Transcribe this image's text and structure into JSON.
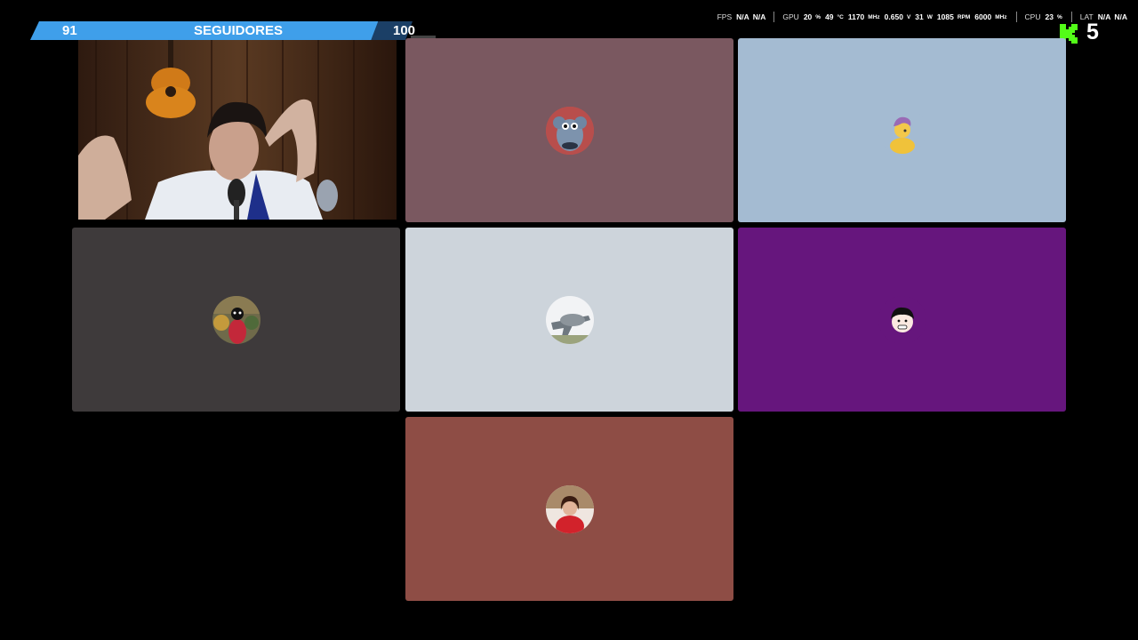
{
  "followers": {
    "current": "91",
    "label": "SEGUIDORES",
    "goal": "100",
    "progress": 0.91,
    "fill_color": "#3f9fea"
  },
  "stats": {
    "fps_label": "FPS",
    "fps_value1": "N/A",
    "fps_value2": "N/A",
    "gpu_label": "GPU",
    "gpu_load": "20",
    "gpu_load_unit": "%",
    "gpu_temp": "49",
    "gpu_temp_unit": "°C",
    "gpu_clock": "1170",
    "gpu_clock_unit": "MHz",
    "gpu_voltage": "0.650",
    "gpu_voltage_unit": "V",
    "gpu_power": "31",
    "gpu_power_unit": "W",
    "gpu_fan": "1085",
    "gpu_fan_unit": "RPM",
    "gpu_mem_clock": "6000",
    "gpu_mem_clock_unit": "MHz",
    "cpu_label": "CPU",
    "cpu_load": "23",
    "cpu_load_unit": "%",
    "lat_label": "LAT",
    "lat_value1": "N/A",
    "lat_value2": "N/A"
  },
  "kick": {
    "viewer_count": "5",
    "brand_color": "#53fc18"
  },
  "tiles": [
    {
      "kind": "camera",
      "icon": "webcam-feed"
    },
    {
      "kind": "avatar",
      "color": "#7a5860",
      "icon": "mouse-plush-avatar"
    },
    {
      "kind": "avatar",
      "color": "#a4bbd2",
      "icon": "cartoon-character-avatar"
    },
    {
      "kind": "avatar",
      "color": "#3e3a3b",
      "icon": "person-photo-avatar"
    },
    {
      "kind": "avatar",
      "color": "#cdd4db",
      "icon": "airplane-avatar"
    },
    {
      "kind": "avatar",
      "color": "#66167d",
      "icon": "cartoon-face-avatar"
    },
    {
      "kind": "avatar",
      "color": "#8e4d45",
      "icon": "woman-photo-avatar"
    }
  ]
}
